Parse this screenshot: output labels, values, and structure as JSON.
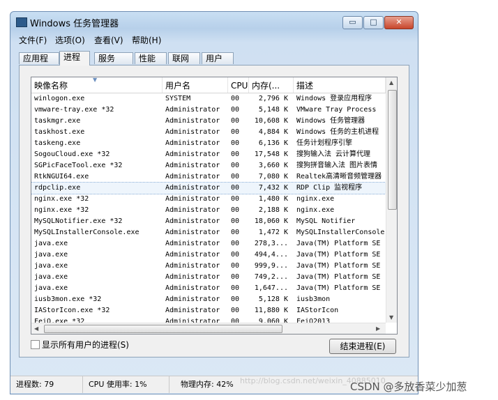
{
  "window": {
    "title": "Windows 任务管理器",
    "controls": {
      "minimize": "▭",
      "maximize": "□",
      "close": "✕"
    }
  },
  "menu": [
    {
      "label": "文件(F)"
    },
    {
      "label": "选项(O)"
    },
    {
      "label": "查看(V)"
    },
    {
      "label": "帮助(H)"
    }
  ],
  "tabs": [
    {
      "label": "应用程序"
    },
    {
      "label": "进程",
      "active": true
    },
    {
      "label": "服务"
    },
    {
      "label": "性能"
    },
    {
      "label": "联网"
    },
    {
      "label": "用户"
    }
  ],
  "process_list": {
    "columns": {
      "name": "映像名称",
      "user": "用户名",
      "cpu": "CPU",
      "mem": "内存(...",
      "desc": "描述"
    },
    "rows": [
      {
        "name": "winlogon.exe",
        "user": "SYSTEM",
        "cpu": "00",
        "mem": "2,796 K",
        "desc": "Windows 登录应用程序"
      },
      {
        "name": "vmware-tray.exe *32",
        "user": "Administrator",
        "cpu": "00",
        "mem": "5,148 K",
        "desc": "VMware Tray Process"
      },
      {
        "name": "taskmgr.exe",
        "user": "Administrator",
        "cpu": "00",
        "mem": "10,608 K",
        "desc": "Windows 任务管理器"
      },
      {
        "name": "taskhost.exe",
        "user": "Administrator",
        "cpu": "00",
        "mem": "4,884 K",
        "desc": "Windows 任务的主机进程"
      },
      {
        "name": "taskeng.exe",
        "user": "Administrator",
        "cpu": "00",
        "mem": "6,136 K",
        "desc": "任务计划程序引擎"
      },
      {
        "name": "SogouCloud.exe *32",
        "user": "Administrator",
        "cpu": "00",
        "mem": "17,548 K",
        "desc": "搜狗输入法 云计算代理"
      },
      {
        "name": "SGPicFaceTool.exe *32",
        "user": "Administrator",
        "cpu": "00",
        "mem": "3,660 K",
        "desc": "搜狗拼音输入法 图片表情"
      },
      {
        "name": "RtkNGUI64.exe",
        "user": "Administrator",
        "cpu": "00",
        "mem": "7,080 K",
        "desc": "Realtek高清晰音频管理器"
      },
      {
        "name": "rdpclip.exe",
        "user": "Administrator",
        "cpu": "00",
        "mem": "7,432 K",
        "desc": "RDP Clip 监视程序",
        "selected": true
      },
      {
        "name": "nginx.exe *32",
        "user": "Administrator",
        "cpu": "00",
        "mem": "1,480 K",
        "desc": "nginx.exe"
      },
      {
        "name": "nginx.exe *32",
        "user": "Administrator",
        "cpu": "00",
        "mem": "2,188 K",
        "desc": "nginx.exe"
      },
      {
        "name": "MySQLNotifier.exe *32",
        "user": "Administrator",
        "cpu": "00",
        "mem": "18,060 K",
        "desc": "MySQL Notifier"
      },
      {
        "name": "MySQLInstallerConsole.exe",
        "user": "Administrator",
        "cpu": "00",
        "mem": "1,472 K",
        "desc": "MySQLInstallerConsole"
      },
      {
        "name": "java.exe",
        "user": "Administrator",
        "cpu": "00",
        "mem": "278,3...",
        "desc": "Java(TM) Platform SE"
      },
      {
        "name": "java.exe",
        "user": "Administrator",
        "cpu": "00",
        "mem": "494,4...",
        "desc": "Java(TM) Platform SE"
      },
      {
        "name": "java.exe",
        "user": "Administrator",
        "cpu": "00",
        "mem": "999,9...",
        "desc": "Java(TM) Platform SE"
      },
      {
        "name": "java.exe",
        "user": "Administrator",
        "cpu": "00",
        "mem": "749,2...",
        "desc": "Java(TM) Platform SE"
      },
      {
        "name": "java.exe",
        "user": "Administrator",
        "cpu": "00",
        "mem": "1,647...",
        "desc": "Java(TM) Platform SE"
      },
      {
        "name": "iusb3mon.exe *32",
        "user": "Administrator",
        "cpu": "00",
        "mem": "5,128 K",
        "desc": "iusb3mon"
      },
      {
        "name": "IAStorIcon.exe *32",
        "user": "Administrator",
        "cpu": "00",
        "mem": "11,880 K",
        "desc": "IAStorIcon"
      },
      {
        "name": "FeiQ.exe *32",
        "user": "Administrator",
        "cpu": "00",
        "mem": "9,060 K",
        "desc": "FeiQ2013"
      }
    ]
  },
  "show_all_users": {
    "label": "显示所有用户的进程(S)",
    "checked": false
  },
  "end_process_button": "结束进程(E)",
  "status": {
    "processes": "进程数: 79",
    "cpu_usage": "CPU 使用率: 1%",
    "physical_memory": "物理内存: 42%"
  },
  "watermark": "http://blog.csdn.net/weixin_40885010",
  "brand": "CSDN @多放香菜少加葱",
  "icons": {
    "sort": "sort-ascending-icon",
    "scroll_up": "scroll-up-icon",
    "scroll_down": "scroll-down-icon"
  }
}
